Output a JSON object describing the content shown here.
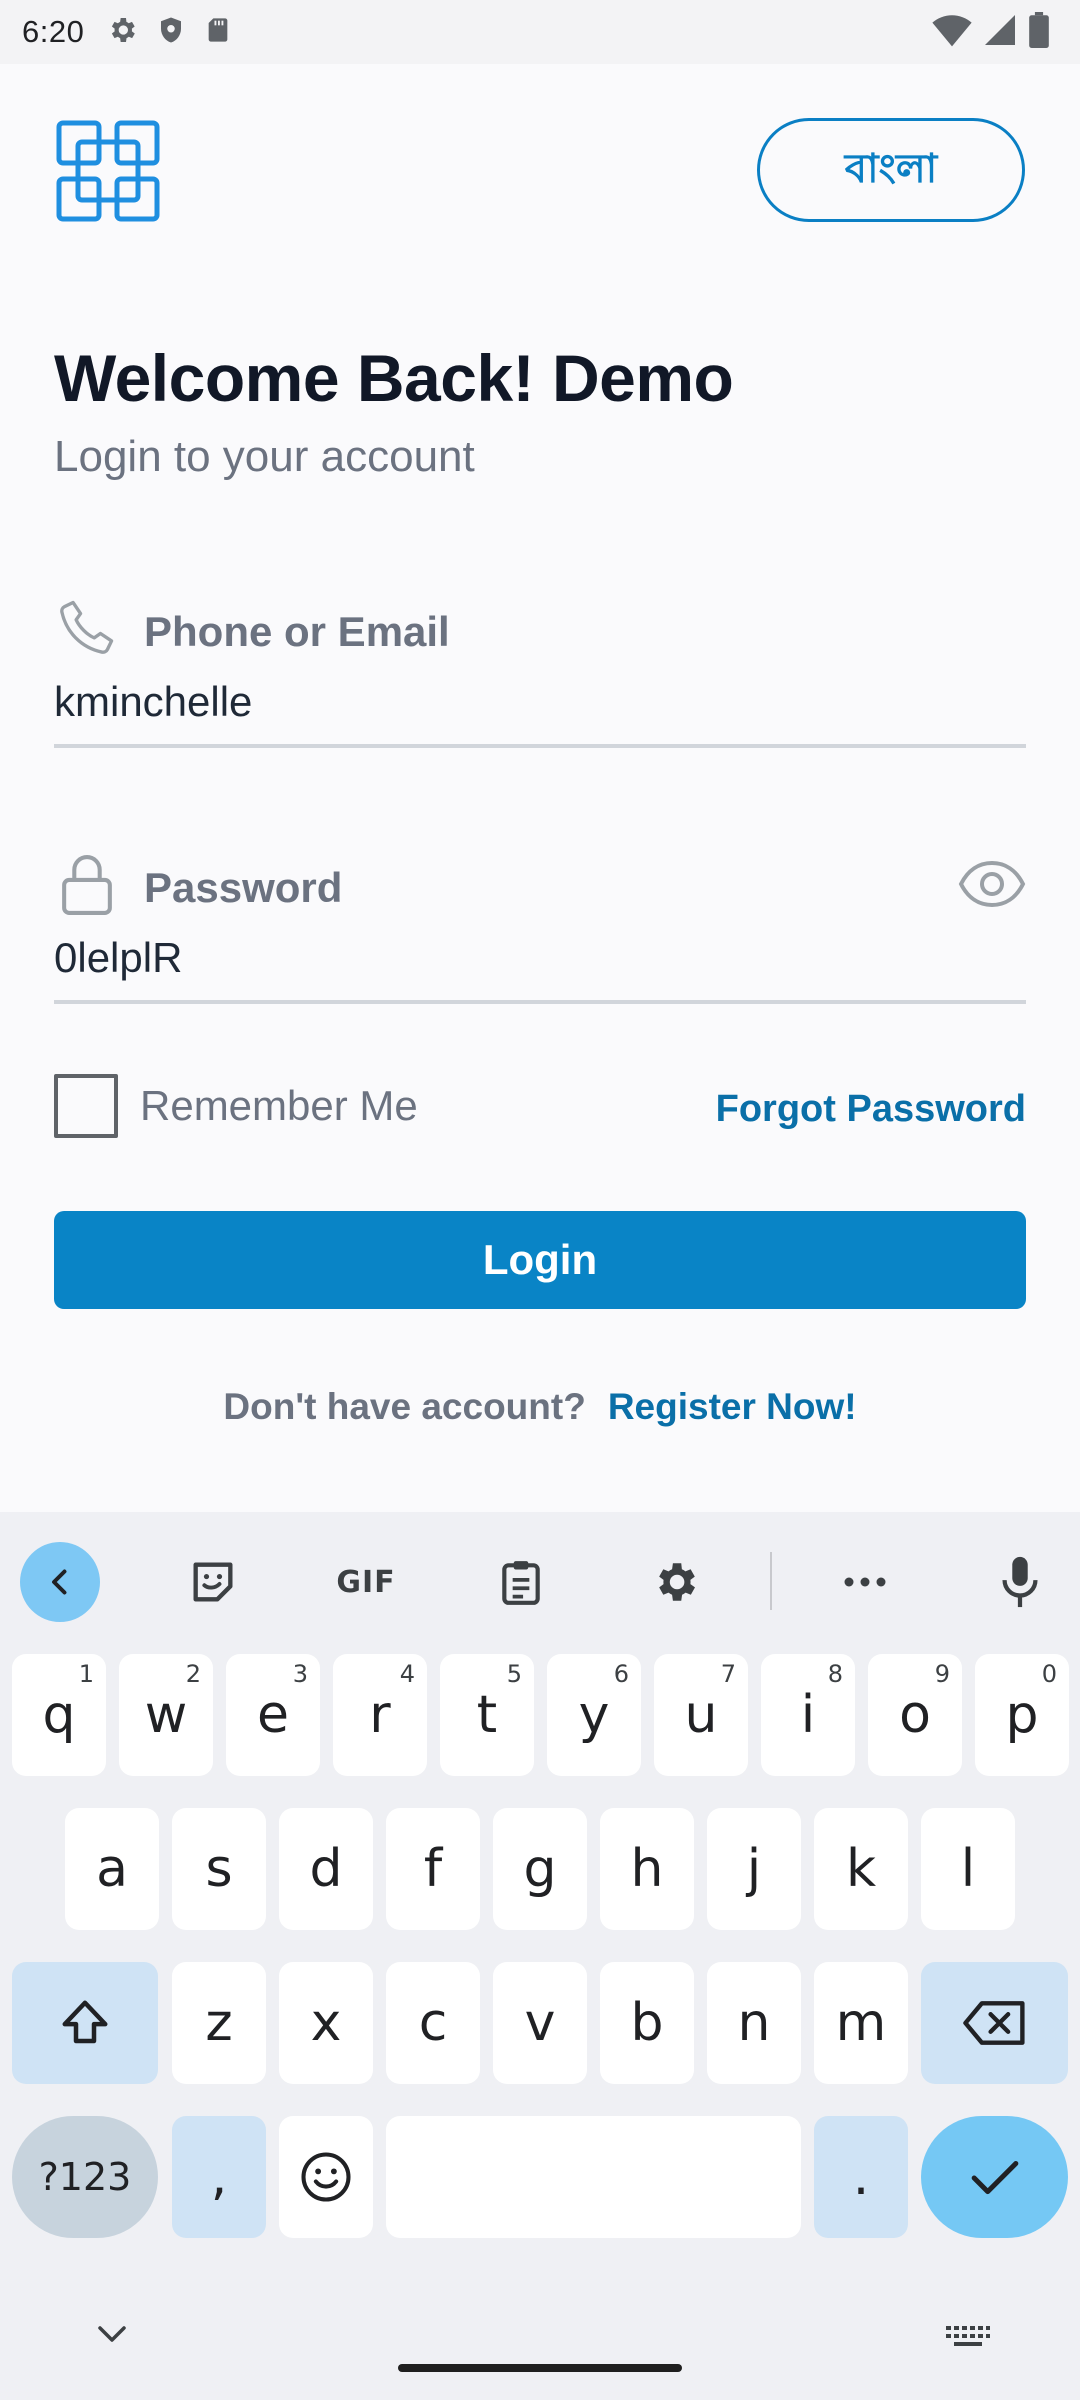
{
  "status_bar": {
    "time": "6:20",
    "left_icons": [
      "gear-icon",
      "shield-icon",
      "sd-card-icon"
    ],
    "right_icons": [
      "wifi-icon",
      "signal-icon",
      "battery-icon"
    ]
  },
  "header": {
    "logo_icon": "app-logo-icon",
    "language_button": "বাংলা"
  },
  "title": "Welcome Back! Demo",
  "subtitle": "Login to your account",
  "form": {
    "phone": {
      "label": "Phone or Email",
      "value": "kminchelle",
      "icon": "phone-icon"
    },
    "password": {
      "label": "Password",
      "value": "0lelplR",
      "icon": "lock-icon",
      "toggle_icon": "eye-icon"
    },
    "remember_label": "Remember Me",
    "remember_checked": false,
    "forgot_label": "Forgot Password",
    "login_label": "Login",
    "register_question": "Don't have account?",
    "register_link": "Register Now!"
  },
  "keyboard": {
    "toolbar": [
      "back-icon",
      "sticker-icon",
      "GIF",
      "clipboard-icon",
      "settings-icon",
      "more-icon",
      "mic-icon"
    ],
    "row1": [
      "q",
      "w",
      "e",
      "r",
      "t",
      "y",
      "u",
      "i",
      "o",
      "p"
    ],
    "row1_hints": [
      "1",
      "2",
      "3",
      "4",
      "5",
      "6",
      "7",
      "8",
      "9",
      "0"
    ],
    "row2": [
      "a",
      "s",
      "d",
      "f",
      "g",
      "h",
      "j",
      "k",
      "l"
    ],
    "row3": [
      "z",
      "x",
      "c",
      "v",
      "b",
      "n",
      "m"
    ],
    "symbols_key": "?123",
    "comma_key": ",",
    "period_key": "."
  },
  "colors": {
    "accent": "#0984c6",
    "link": "#0a6fa8",
    "label_gray": "#6b7280",
    "keyboard_bg": "#eff0f4",
    "enter_key": "#75c8f4"
  }
}
